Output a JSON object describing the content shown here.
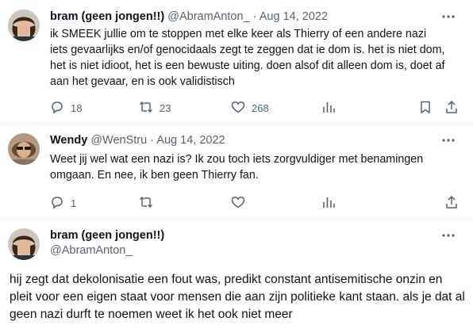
{
  "tweets": [
    {
      "name": "bram (geen jongen!!)",
      "handle": "@AbramAnton_",
      "separator": "·",
      "date": "Aug 14, 2022",
      "text": "ik SMEEK jullie om te stoppen met elke keer als Thierry of een andere nazi iets gevaarlijks en/of genocidaals zegt te zeggen dat ie dom is. het is niet dom, het is niet idioot, het is een bewuste uiting. doen alsof dit alleen dom is, doet af aan het gevaar, en is ook validistisch",
      "replies": "18",
      "retweets": "23",
      "likes": "268"
    },
    {
      "name": "Wendy",
      "handle": "@WenStru",
      "separator": "·",
      "date": "Aug 14, 2022",
      "text": "Weet jij wel wat een nazi is? Ik zou toch iets zorgvuldiger met benamingen omgaan. En nee, ik ben geen Thierry fan.",
      "replies": "1",
      "retweets": "",
      "likes": ""
    },
    {
      "name": "bram (geen jongen!!)",
      "handle": "@AbramAnton_",
      "text": "hij zegt dat dekolonisatie een fout was,  predikt constant antisemitische onzin en pleit voor een eigen staat voor mensen die aan zijn politieke kant staan. als je dat al geen nazi durft te noemen weet ik het ook niet meer"
    }
  ],
  "icons": {
    "reply": "reply-icon",
    "retweet": "retweet-icon",
    "like": "heart-icon",
    "views": "views-icon",
    "bookmark": "bookmark-icon",
    "share": "share-icon",
    "more": "more-icon"
  },
  "colors": {
    "text": "#0f1419",
    "secondary": "#536471",
    "divider": "#eff3f4"
  }
}
